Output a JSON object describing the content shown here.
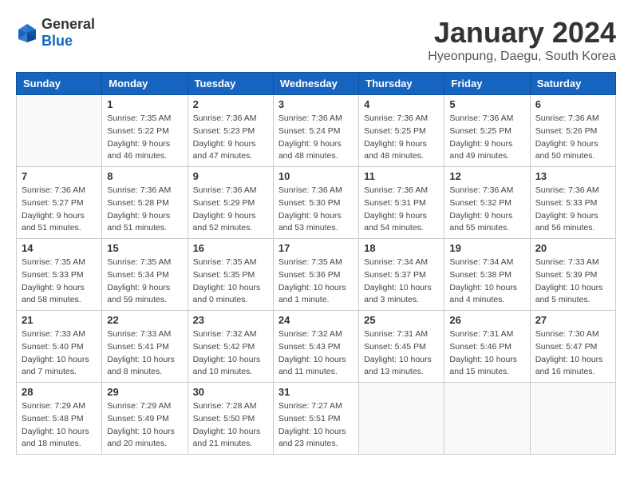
{
  "header": {
    "logo_general": "General",
    "logo_blue": "Blue",
    "title": "January 2024",
    "subtitle": "Hyeonpung, Daegu, South Korea"
  },
  "calendar": {
    "days_of_week": [
      "Sunday",
      "Monday",
      "Tuesday",
      "Wednesday",
      "Thursday",
      "Friday",
      "Saturday"
    ],
    "weeks": [
      [
        {
          "day": "",
          "sunrise": "",
          "sunset": "",
          "daylight": "",
          "empty": true
        },
        {
          "day": "1",
          "sunrise": "Sunrise: 7:35 AM",
          "sunset": "Sunset: 5:22 PM",
          "daylight": "Daylight: 9 hours and 46 minutes."
        },
        {
          "day": "2",
          "sunrise": "Sunrise: 7:36 AM",
          "sunset": "Sunset: 5:23 PM",
          "daylight": "Daylight: 9 hours and 47 minutes."
        },
        {
          "day": "3",
          "sunrise": "Sunrise: 7:36 AM",
          "sunset": "Sunset: 5:24 PM",
          "daylight": "Daylight: 9 hours and 48 minutes."
        },
        {
          "day": "4",
          "sunrise": "Sunrise: 7:36 AM",
          "sunset": "Sunset: 5:25 PM",
          "daylight": "Daylight: 9 hours and 48 minutes."
        },
        {
          "day": "5",
          "sunrise": "Sunrise: 7:36 AM",
          "sunset": "Sunset: 5:25 PM",
          "daylight": "Daylight: 9 hours and 49 minutes."
        },
        {
          "day": "6",
          "sunrise": "Sunrise: 7:36 AM",
          "sunset": "Sunset: 5:26 PM",
          "daylight": "Daylight: 9 hours and 50 minutes."
        }
      ],
      [
        {
          "day": "7",
          "sunrise": "Sunrise: 7:36 AM",
          "sunset": "Sunset: 5:27 PM",
          "daylight": "Daylight: 9 hours and 51 minutes."
        },
        {
          "day": "8",
          "sunrise": "Sunrise: 7:36 AM",
          "sunset": "Sunset: 5:28 PM",
          "daylight": "Daylight: 9 hours and 51 minutes."
        },
        {
          "day": "9",
          "sunrise": "Sunrise: 7:36 AM",
          "sunset": "Sunset: 5:29 PM",
          "daylight": "Daylight: 9 hours and 52 minutes."
        },
        {
          "day": "10",
          "sunrise": "Sunrise: 7:36 AM",
          "sunset": "Sunset: 5:30 PM",
          "daylight": "Daylight: 9 hours and 53 minutes."
        },
        {
          "day": "11",
          "sunrise": "Sunrise: 7:36 AM",
          "sunset": "Sunset: 5:31 PM",
          "daylight": "Daylight: 9 hours and 54 minutes."
        },
        {
          "day": "12",
          "sunrise": "Sunrise: 7:36 AM",
          "sunset": "Sunset: 5:32 PM",
          "daylight": "Daylight: 9 hours and 55 minutes."
        },
        {
          "day": "13",
          "sunrise": "Sunrise: 7:36 AM",
          "sunset": "Sunset: 5:33 PM",
          "daylight": "Daylight: 9 hours and 56 minutes."
        }
      ],
      [
        {
          "day": "14",
          "sunrise": "Sunrise: 7:35 AM",
          "sunset": "Sunset: 5:33 PM",
          "daylight": "Daylight: 9 hours and 58 minutes."
        },
        {
          "day": "15",
          "sunrise": "Sunrise: 7:35 AM",
          "sunset": "Sunset: 5:34 PM",
          "daylight": "Daylight: 9 hours and 59 minutes."
        },
        {
          "day": "16",
          "sunrise": "Sunrise: 7:35 AM",
          "sunset": "Sunset: 5:35 PM",
          "daylight": "Daylight: 10 hours and 0 minutes."
        },
        {
          "day": "17",
          "sunrise": "Sunrise: 7:35 AM",
          "sunset": "Sunset: 5:36 PM",
          "daylight": "Daylight: 10 hours and 1 minute."
        },
        {
          "day": "18",
          "sunrise": "Sunrise: 7:34 AM",
          "sunset": "Sunset: 5:37 PM",
          "daylight": "Daylight: 10 hours and 3 minutes."
        },
        {
          "day": "19",
          "sunrise": "Sunrise: 7:34 AM",
          "sunset": "Sunset: 5:38 PM",
          "daylight": "Daylight: 10 hours and 4 minutes."
        },
        {
          "day": "20",
          "sunrise": "Sunrise: 7:33 AM",
          "sunset": "Sunset: 5:39 PM",
          "daylight": "Daylight: 10 hours and 5 minutes."
        }
      ],
      [
        {
          "day": "21",
          "sunrise": "Sunrise: 7:33 AM",
          "sunset": "Sunset: 5:40 PM",
          "daylight": "Daylight: 10 hours and 7 minutes."
        },
        {
          "day": "22",
          "sunrise": "Sunrise: 7:33 AM",
          "sunset": "Sunset: 5:41 PM",
          "daylight": "Daylight: 10 hours and 8 minutes."
        },
        {
          "day": "23",
          "sunrise": "Sunrise: 7:32 AM",
          "sunset": "Sunset: 5:42 PM",
          "daylight": "Daylight: 10 hours and 10 minutes."
        },
        {
          "day": "24",
          "sunrise": "Sunrise: 7:32 AM",
          "sunset": "Sunset: 5:43 PM",
          "daylight": "Daylight: 10 hours and 11 minutes."
        },
        {
          "day": "25",
          "sunrise": "Sunrise: 7:31 AM",
          "sunset": "Sunset: 5:45 PM",
          "daylight": "Daylight: 10 hours and 13 minutes."
        },
        {
          "day": "26",
          "sunrise": "Sunrise: 7:31 AM",
          "sunset": "Sunset: 5:46 PM",
          "daylight": "Daylight: 10 hours and 15 minutes."
        },
        {
          "day": "27",
          "sunrise": "Sunrise: 7:30 AM",
          "sunset": "Sunset: 5:47 PM",
          "daylight": "Daylight: 10 hours and 16 minutes."
        }
      ],
      [
        {
          "day": "28",
          "sunrise": "Sunrise: 7:29 AM",
          "sunset": "Sunset: 5:48 PM",
          "daylight": "Daylight: 10 hours and 18 minutes."
        },
        {
          "day": "29",
          "sunrise": "Sunrise: 7:29 AM",
          "sunset": "Sunset: 5:49 PM",
          "daylight": "Daylight: 10 hours and 20 minutes."
        },
        {
          "day": "30",
          "sunrise": "Sunrise: 7:28 AM",
          "sunset": "Sunset: 5:50 PM",
          "daylight": "Daylight: 10 hours and 21 minutes."
        },
        {
          "day": "31",
          "sunrise": "Sunrise: 7:27 AM",
          "sunset": "Sunset: 5:51 PM",
          "daylight": "Daylight: 10 hours and 23 minutes."
        },
        {
          "day": "",
          "sunrise": "",
          "sunset": "",
          "daylight": "",
          "empty": true
        },
        {
          "day": "",
          "sunrise": "",
          "sunset": "",
          "daylight": "",
          "empty": true
        },
        {
          "day": "",
          "sunrise": "",
          "sunset": "",
          "daylight": "",
          "empty": true
        }
      ]
    ]
  }
}
